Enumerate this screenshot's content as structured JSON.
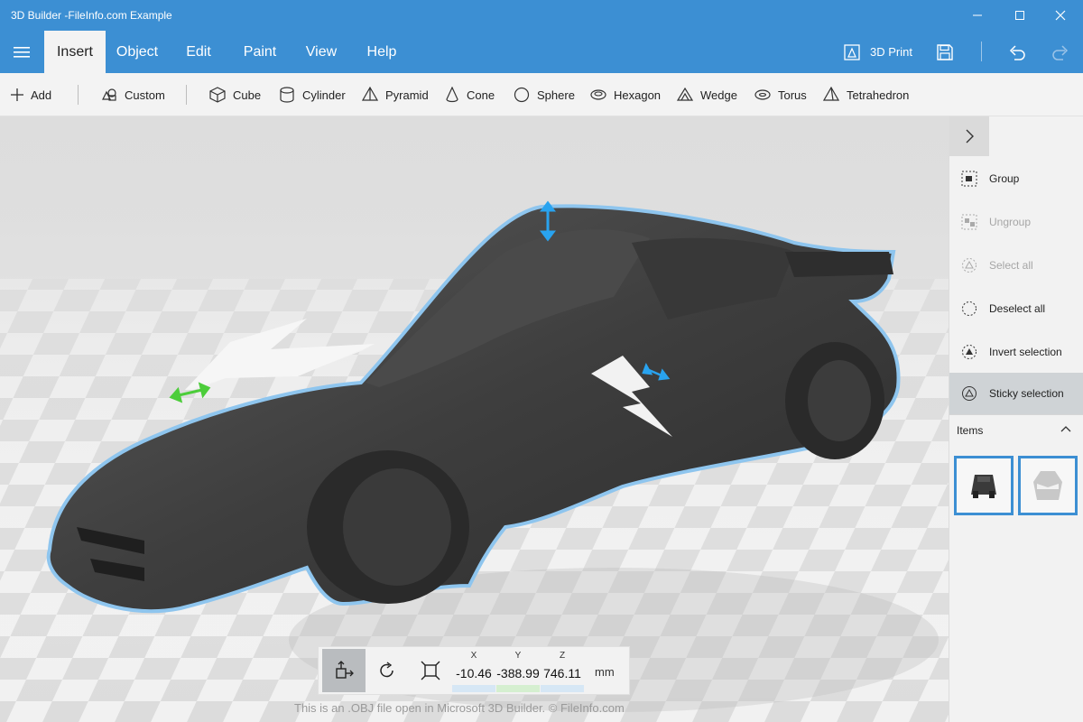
{
  "window": {
    "title": "3D Builder -FileInfo.com Example",
    "accent_color": "#3c8fd3"
  },
  "ribbon": {
    "tabs": [
      "Insert",
      "Object",
      "Edit",
      "Paint",
      "View",
      "Help"
    ],
    "active_tab": "Insert",
    "print_label": "3D Print"
  },
  "toolbar": {
    "add_label": "Add",
    "custom_label": "Custom",
    "shapes": [
      "Cube",
      "Cylinder",
      "Pyramid",
      "Cone",
      "Sphere",
      "Hexagon",
      "Wedge",
      "Torus",
      "Tetrahedron"
    ]
  },
  "side_panel": {
    "actions": [
      {
        "label": "Group",
        "enabled": true,
        "icon": "group-icon"
      },
      {
        "label": "Ungroup",
        "enabled": false,
        "icon": "ungroup-icon"
      },
      {
        "label": "Select all",
        "enabled": false,
        "icon": "select-all-icon"
      },
      {
        "label": "Deselect all",
        "enabled": true,
        "icon": "deselect-all-icon"
      },
      {
        "label": "Invert selection",
        "enabled": true,
        "icon": "invert-selection-icon"
      },
      {
        "label": "Sticky selection",
        "enabled": true,
        "active": true,
        "icon": "sticky-selection-icon"
      }
    ],
    "items_label": "Items"
  },
  "transform": {
    "modes": [
      "move",
      "rotate",
      "scale"
    ],
    "active_mode": "move",
    "x_label": "X",
    "x_value": "-10.46",
    "y_label": "Y",
    "y_value": "-388.99",
    "z_label": "Z",
    "z_value": "746.11",
    "unit": "mm"
  },
  "footer": {
    "watermark": "This is an .OBJ file open in Microsoft 3D Builder. © FileInfo.com"
  }
}
